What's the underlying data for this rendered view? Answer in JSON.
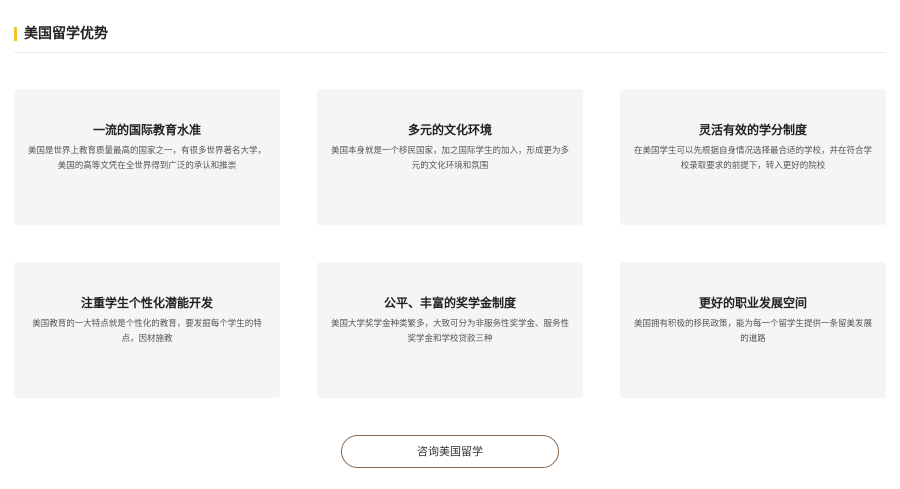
{
  "section": {
    "title": "美国留学优势",
    "accent_color": "#f2c230"
  },
  "cards": [
    {
      "title": "一流的国际教育水准",
      "description": "美国是世界上教育质量最高的国家之一，有很多世界著名大学，美国的高等文凭在全世界得到广泛的承认和推崇"
    },
    {
      "title": "多元的文化环境",
      "description": "美国本身就是一个移民国家，加之国际学生的加入，形成更为多元的文化环境和氛围"
    },
    {
      "title": "灵活有效的学分制度",
      "description": "在美国学生可以先根据自身情况选择最合适的学校，并在符合学校录取要求的前提下，转入更好的院校"
    },
    {
      "title": "注重学生个性化潜能开发",
      "description": "美国教育的一大特点就是个性化的教育，要发掘每个学生的特点，因材施教"
    },
    {
      "title": "公平、丰富的奖学金制度",
      "description": "美国大学奖学金种类繁多，大致可分为非服务性奖学金、服务性奖学金和学校贷款三种"
    },
    {
      "title": "更好的职业发展空间",
      "description": "美国拥有积极的移民政策，能为每一个留学生提供一条留美发展的道路"
    }
  ],
  "cta": {
    "label": "咨询美国留学",
    "border_color": "#8b6a4f"
  }
}
